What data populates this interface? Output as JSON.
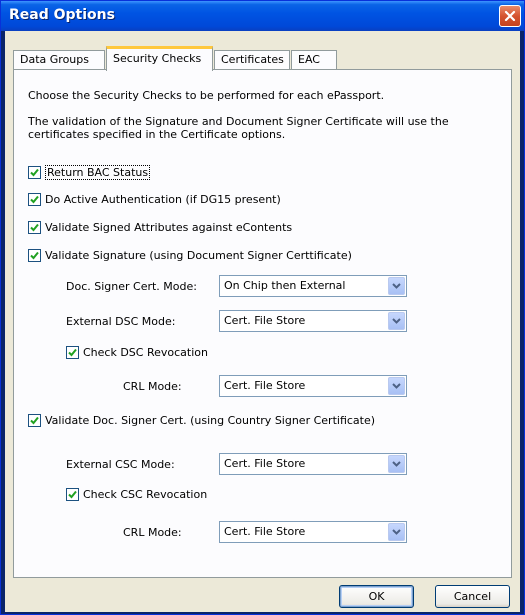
{
  "window": {
    "title": "Read Options"
  },
  "tabs": [
    {
      "label": "Data Groups"
    },
    {
      "label": "Security Checks"
    },
    {
      "label": "Certificates"
    },
    {
      "label": "EAC"
    }
  ],
  "intro": {
    "line1": "Choose the Security Checks to be performed for each ePassport.",
    "line2a": "The validation of the Signature and Document Signer Certificate will use the",
    "line2b": "certificates specified in the Certificate options."
  },
  "checks": {
    "return_bac": {
      "label": "Return BAC Status",
      "checked": true
    },
    "active_auth": {
      "label": "Do Active Authentication (if DG15 present)",
      "checked": true
    },
    "validate_signed_attrs": {
      "label": "Validate Signed Attributes against eContents",
      "checked": true
    },
    "validate_signature": {
      "label": "Validate Signature (using Document Signer Certtificate)",
      "checked": true
    },
    "check_dsc_revocation": {
      "label": "Check DSC Revocation",
      "checked": true
    },
    "validate_doc_signer": {
      "label": "Validate Doc. Signer Cert. (using Country Signer Certificate)",
      "checked": true
    },
    "check_csc_revocation": {
      "label": "Check CSC Revocation",
      "checked": true
    }
  },
  "fields": {
    "doc_signer_mode": {
      "label": "Doc. Signer Cert. Mode:",
      "value": "On Chip then External"
    },
    "external_dsc_mode": {
      "label": "External DSC Mode:",
      "value": "Cert. File Store"
    },
    "dsc_crl_mode": {
      "label": "CRL Mode:",
      "value": "Cert. File Store"
    },
    "external_csc_mode": {
      "label": "External CSC Mode:",
      "value": "Cert. File Store"
    },
    "csc_crl_mode": {
      "label": "CRL Mode:",
      "value": "Cert. File Store"
    }
  },
  "buttons": {
    "ok": "OK",
    "cancel": "Cancel"
  },
  "icons": {
    "close": "close-icon",
    "check": "checkmark-icon",
    "dropdown": "chevron-down-icon"
  },
  "colors": {
    "titlebar": "#0054e3",
    "close": "#d5532f",
    "tab_accent": "#ffc83c",
    "checkmark": "#21a121",
    "dialog": "#ece9d8"
  }
}
